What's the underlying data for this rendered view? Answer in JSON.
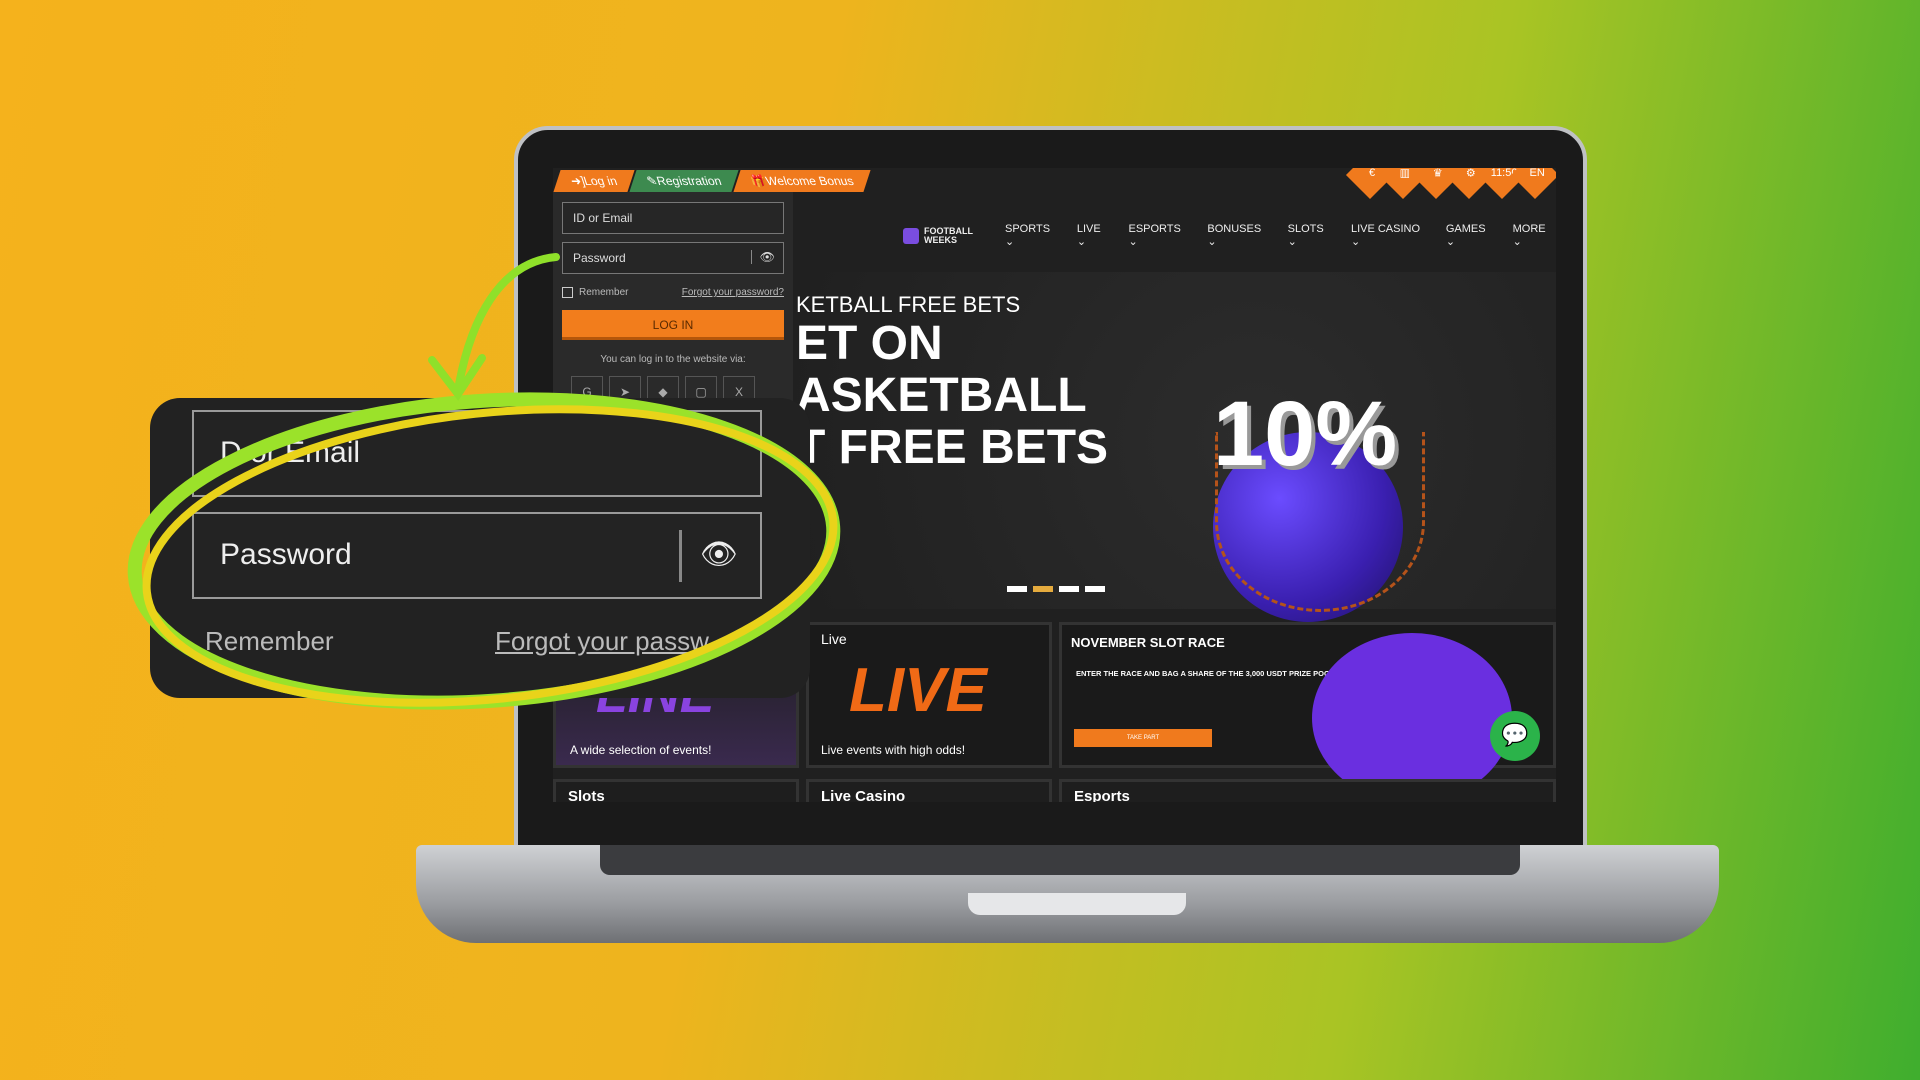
{
  "top_tabs": {
    "login": "Log in",
    "registration": "Registration",
    "welcome_bonus": "Welcome Bonus"
  },
  "login_form": {
    "id_placeholder": "ID or Email",
    "password_placeholder": "Password",
    "remember": "Remember",
    "forgot": "Forgot your password?",
    "login_button": "LOG IN",
    "via_text": "You can log in to the website via:",
    "social": [
      "G",
      "telegram",
      "metamask",
      "twitch",
      "X"
    ]
  },
  "header": {
    "logo": "FOOTBALL WEEKS",
    "nav": [
      "SPORTS",
      "LIVE",
      "ESPORTS",
      "BONUSES",
      "SLOTS",
      "LIVE CASINO",
      "GAMES",
      "MORE"
    ],
    "utility": [
      "€",
      "stats",
      "trophy",
      "settings",
      "11:50",
      "EN"
    ]
  },
  "hero": {
    "subtitle": "KETBALL FREE BETS",
    "line1": "ET ON",
    "line2": "ASKETBALL",
    "line3": "T FREE BETS",
    "percent": "10%",
    "slides": 4,
    "active_slide": 2
  },
  "cards": [
    {
      "title": "",
      "caption": "A wide selection of events!",
      "art": "LINE"
    },
    {
      "title": "Live",
      "caption": "Live events with high odds!",
      "art": "LIVE"
    },
    {
      "title": "NOVEMBER SLOT RACE",
      "caption": "ENTER THE RACE AND BAG A SHARE OF THE 3,000 USDT PRIZE POOL!",
      "button": "TAKE PART"
    }
  ],
  "cards_row2": [
    "Slots",
    "Live Casino",
    "Esports"
  ],
  "callout": {
    "id_field": "D or Email",
    "password_field": "Password",
    "remember": "Remember",
    "forgot": "Forgot your passw"
  },
  "colors": {
    "orange": "#f27d1c",
    "green": "#3d8a4f",
    "chat": "#2bb34a"
  }
}
